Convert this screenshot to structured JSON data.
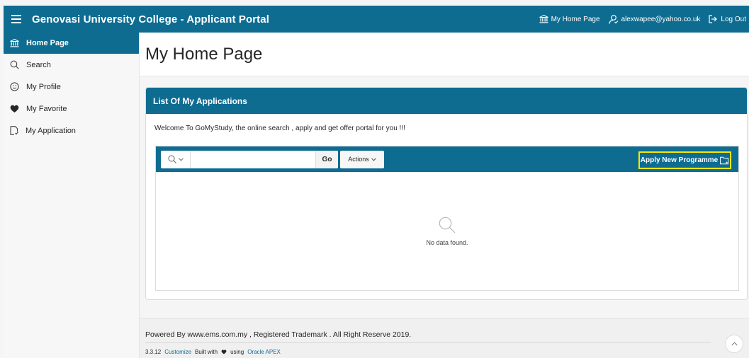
{
  "header": {
    "app_title": "Genovasi University College - Applicant Portal",
    "home_link": "My Home Page",
    "user_email": "alexwapee@yahoo.co.uk",
    "logout_label": "Log Out"
  },
  "sidebar": {
    "items": [
      {
        "label": "Home Page",
        "icon": "bank-icon",
        "active": true
      },
      {
        "label": "Search",
        "icon": "search-icon"
      },
      {
        "label": "My Profile",
        "icon": "smiley-icon"
      },
      {
        "label": "My Favorite",
        "icon": "heart-icon"
      },
      {
        "label": "My Application",
        "icon": "document-icon"
      }
    ]
  },
  "main": {
    "page_title": "My Home Page",
    "region_title": "List Of My Applications",
    "welcome_text": "Welcome To GoMyStudy, the online search , apply and get offer portal for you !!!",
    "report": {
      "search_value": "",
      "go_label": "Go",
      "actions_label": "Actions",
      "apply_label": "Apply New Programme",
      "no_data_label": "No data found."
    }
  },
  "footer": {
    "powered_text": "Powered By www.ems.com.my , Registered Trademark . All Right Reserve 2019.",
    "version": "3.3.12",
    "customize_label": "Customize",
    "built_with_label": "Built with",
    "using_label": "using",
    "apex_label": "Oracle APEX"
  },
  "colors": {
    "primary": "#0f6c91",
    "highlight": "#f5e800"
  }
}
